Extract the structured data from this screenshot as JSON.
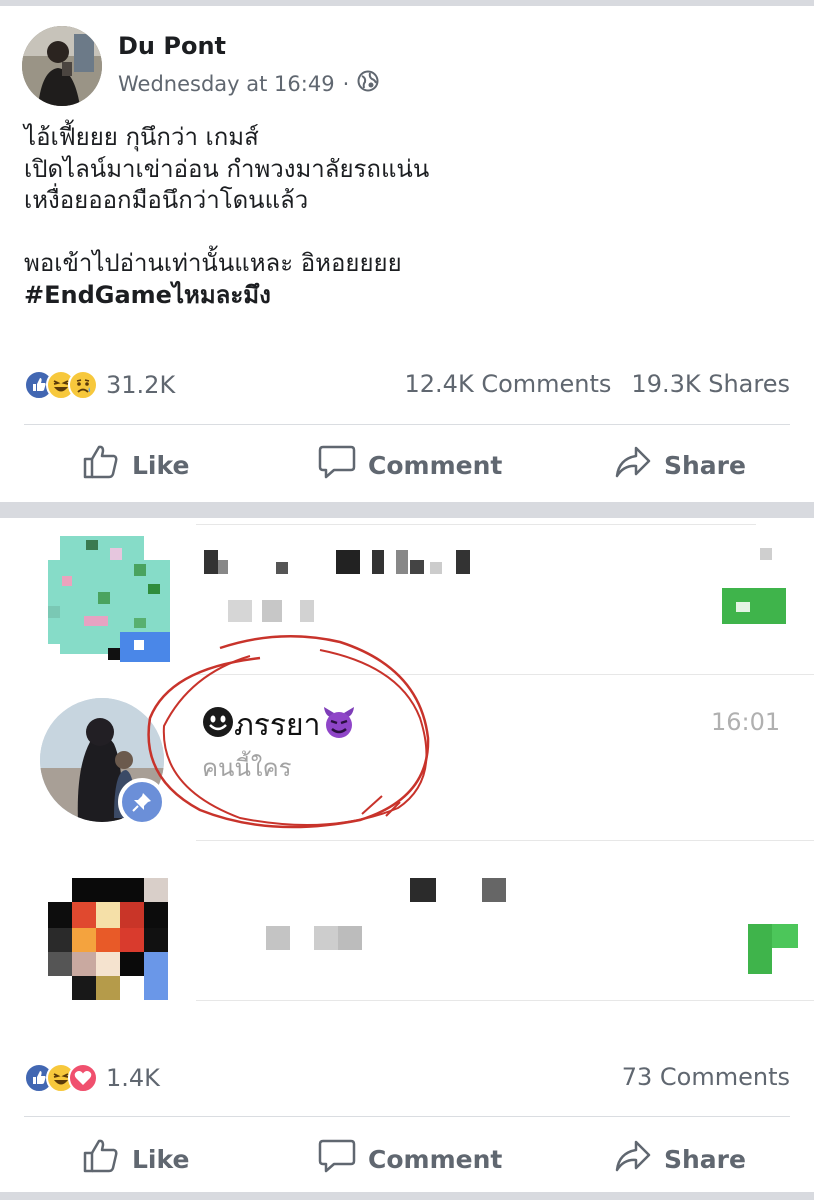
{
  "post": {
    "author": "Du Pont",
    "timestamp": "Wednesday at 16:49",
    "separator": "·",
    "privacy_icon": "globe-icon",
    "body_lines": [
      "ไอ้เฟี้ยยย กุนึกว่า เกมส์",
      "เปิดไลน์มาเข่าอ่อน กำพวงมาลัยรถแน่น",
      "เหงื่อยออกมือนึกว่าโดนแล้ว",
      "",
      "พอเข้าไปอ่านเท่านั้นแหละ อิหอยยยย"
    ],
    "hashtag": "#EndGameไหมละมึง",
    "reactions": [
      "like",
      "haha",
      "sad"
    ],
    "reaction_count": "31.2K",
    "comments_count": "12.4K Comments",
    "shares_count": "19.3K Shares"
  },
  "actions": {
    "like": "Like",
    "comment": "Comment",
    "share": "Share"
  },
  "chat": {
    "pinned_name_emoji_left": "☻",
    "pinned_name": "ภรรยา",
    "pinned_name_emoji_right": "😈",
    "pinned_preview": "คนนี้ใคร",
    "pinned_time": "16:01",
    "pin_icon": "pin-icon"
  },
  "footer": {
    "reactions": [
      "like",
      "haha",
      "love"
    ],
    "reaction_count": "1.4K",
    "comments_count": "73 Comments"
  },
  "colors": {
    "like_blue": "#4267b2",
    "haha_yellow": "#f7c83c",
    "love_red": "#f0506e",
    "annotation_red": "#c8332b",
    "meta_gray": "#606770"
  }
}
